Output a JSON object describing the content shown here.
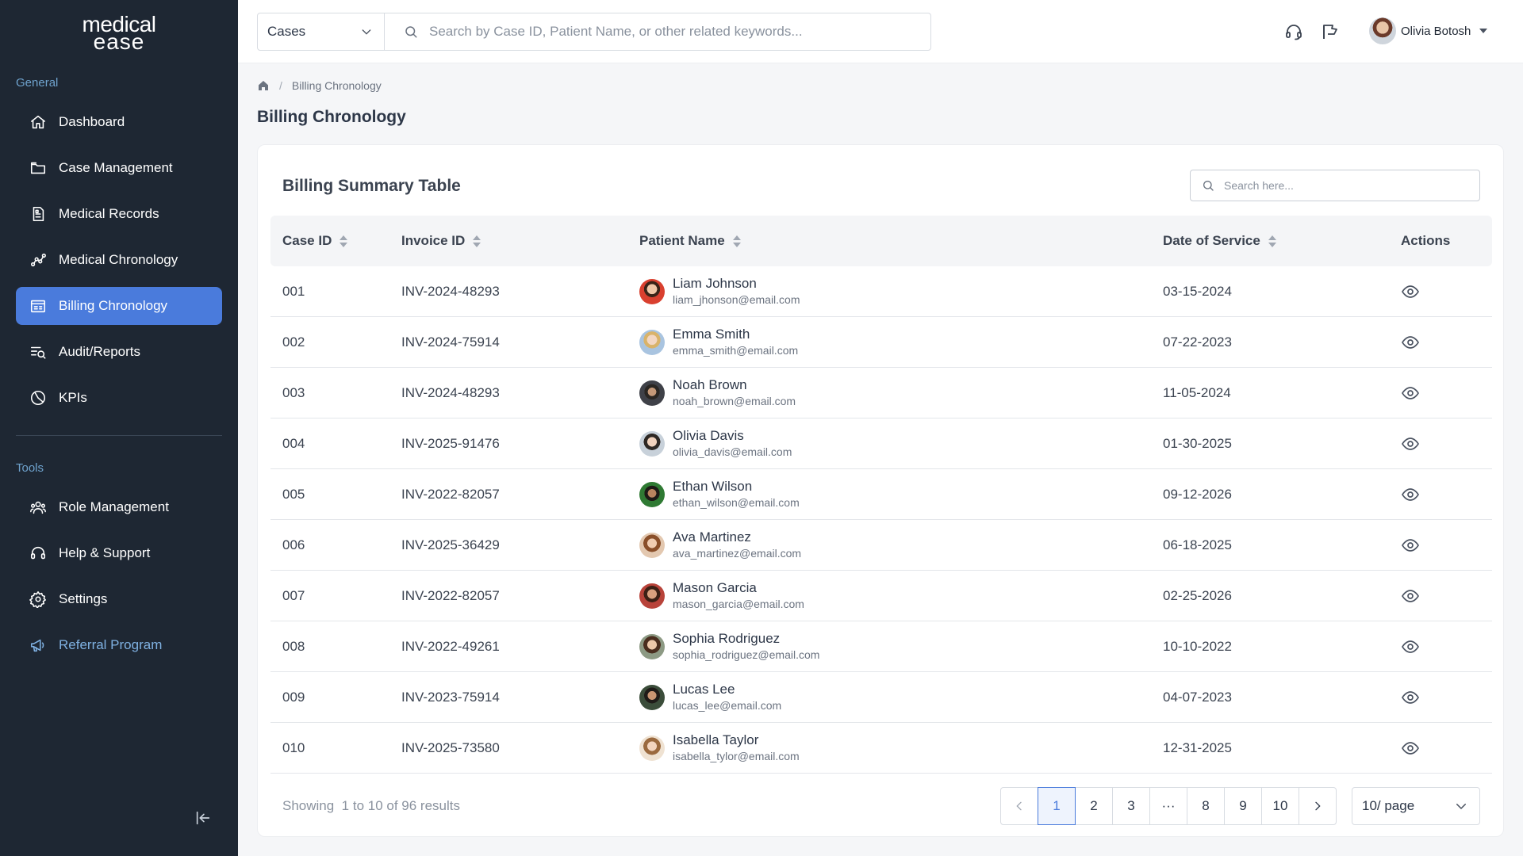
{
  "app": {
    "logo_line1": "medical",
    "logo_line2": "ease"
  },
  "sidebar": {
    "general_label": "General",
    "tools_label": "Tools",
    "general_items": [
      {
        "label": "Dashboard",
        "icon": "home-icon"
      },
      {
        "label": "Case Management",
        "icon": "folder-icon"
      },
      {
        "label": "Medical Records",
        "icon": "document-icon"
      },
      {
        "label": "Medical Chronology",
        "icon": "chart-line-icon"
      },
      {
        "label": "Billing Chronology",
        "icon": "billing-icon",
        "active": true
      },
      {
        "label": "Audit/Reports",
        "icon": "report-search-icon"
      },
      {
        "label": "KPIs",
        "icon": "pie-chart-icon"
      }
    ],
    "tool_items": [
      {
        "label": "Role Management",
        "icon": "users-icon"
      },
      {
        "label": "Help & Support",
        "icon": "headset-icon"
      },
      {
        "label": "Settings",
        "icon": "gear-icon"
      },
      {
        "label": "Referral Program",
        "icon": "megaphone-icon"
      }
    ]
  },
  "topbar": {
    "scope_select": "Cases",
    "search_placeholder": "Search by Case ID, Patient Name, or other related keywords...",
    "user_name": "Olivia Botosh"
  },
  "breadcrumb": {
    "current": "Billing Chronology"
  },
  "page": {
    "title": "Billing Chronology"
  },
  "table": {
    "title": "Billing Summary Table",
    "search_placeholder": "Search here...",
    "columns": [
      "Case ID",
      "Invoice ID",
      "Patient Name",
      "Date of Service",
      "Actions"
    ],
    "rows": [
      {
        "case_id": "001",
        "invoice_id": "INV-2024-48293",
        "name": "Liam Johnson",
        "email": "liam_jhonson@email.com",
        "date": "03-15-2024"
      },
      {
        "case_id": "002",
        "invoice_id": "INV-2024-75914",
        "name": "Emma Smith",
        "email": "emma_smith@email.com",
        "date": "07-22-2023"
      },
      {
        "case_id": "003",
        "invoice_id": "INV-2024-48293",
        "name": "Noah Brown",
        "email": "noah_brown@email.com",
        "date": "11-05-2024"
      },
      {
        "case_id": "004",
        "invoice_id": "INV-2025-91476",
        "name": "Olivia Davis",
        "email": "olivia_davis@email.com",
        "date": "01-30-2025"
      },
      {
        "case_id": "005",
        "invoice_id": "INV-2022-82057",
        "name": "Ethan Wilson",
        "email": "ethan_wilson@email.com",
        "date": "09-12-2026"
      },
      {
        "case_id": "006",
        "invoice_id": "INV-2025-36429",
        "name": "Ava Martinez",
        "email": "ava_martinez@email.com",
        "date": "06-18-2025"
      },
      {
        "case_id": "007",
        "invoice_id": "INV-2022-82057",
        "name": "Mason Garcia",
        "email": "mason_garcia@email.com",
        "date": "02-25-2026"
      },
      {
        "case_id": "008",
        "invoice_id": "INV-2022-49261",
        "name": "Sophia Rodriguez",
        "email": "sophia_rodriguez@email.com",
        "date": "10-10-2022"
      },
      {
        "case_id": "009",
        "invoice_id": "INV-2023-75914",
        "name": "Lucas Lee",
        "email": "lucas_lee@email.com",
        "date": "04-07-2023"
      },
      {
        "case_id": "010",
        "invoice_id": "INV-2025-73580",
        "name": "Isabella Taylor",
        "email": "isabella_tylor@email.com",
        "date": "12-31-2025"
      }
    ]
  },
  "pagination": {
    "showing_label": "Showing",
    "showing_range": "1 to 10 of 96 results",
    "pages": [
      "1",
      "2",
      "3",
      "···",
      "8",
      "9",
      "10"
    ],
    "current_page": "1",
    "per_page": "10/ page"
  },
  "colors": {
    "sidebar_bg": "#1e2733",
    "accent": "#4a7bdc",
    "referral": "#7fb1e2"
  }
}
